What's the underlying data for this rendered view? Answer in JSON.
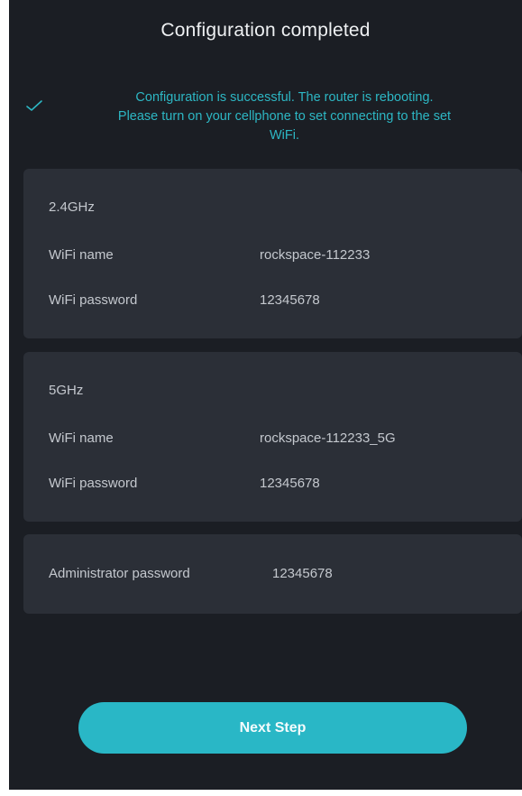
{
  "header": {
    "title": "Configuration completed"
  },
  "status": {
    "icon": "checkmark-icon",
    "color": "#2db7c4",
    "line1": "Configuration is successful. The router is rebooting.",
    "line2": "Please turn on your cellphone to set connecting to the set",
    "line3": "WiFi."
  },
  "band_24": {
    "label": "2.4GHz",
    "wifi_name_label": "WiFi name",
    "wifi_name_value": "rockspace-112233",
    "wifi_password_label": "WiFi password",
    "wifi_password_value": "12345678"
  },
  "band_5": {
    "label": "5GHz",
    "wifi_name_label": "WiFi name",
    "wifi_name_value": "rockspace-112233_5G",
    "wifi_password_label": "WiFi password",
    "wifi_password_value": "12345678"
  },
  "admin": {
    "label": "Administrator password",
    "value": "12345678"
  },
  "footer": {
    "next_label": "Next Step",
    "accent": "#29b7c6"
  },
  "colors": {
    "background": "#1b1e24",
    "card": "#2b2f37"
  }
}
